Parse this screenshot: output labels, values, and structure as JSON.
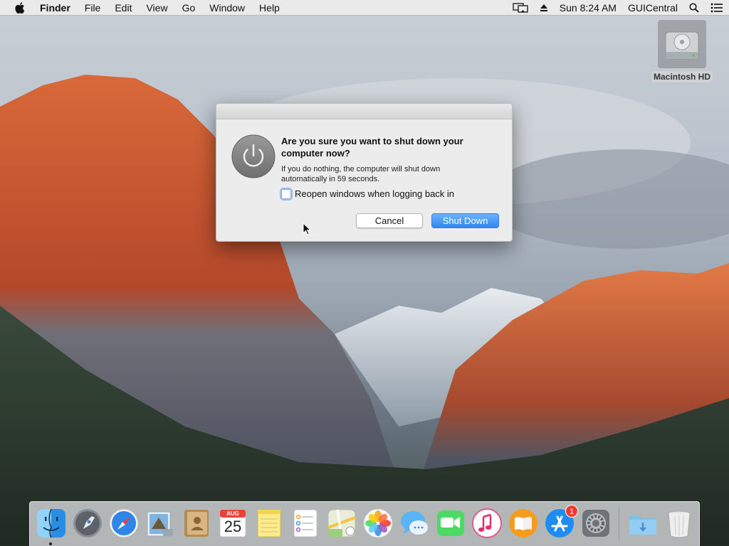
{
  "menubar": {
    "app_name": "Finder",
    "menus": [
      "File",
      "Edit",
      "View",
      "Go",
      "Window",
      "Help"
    ],
    "clock": "Sun 8:24 AM",
    "username": "GUICentral"
  },
  "desktop": {
    "icons": [
      {
        "label": "Macintosh HD",
        "icon": "hard-drive-icon"
      }
    ]
  },
  "dialog": {
    "title": "Are you sure you want to shut down your computer now?",
    "message": "If you do nothing, the computer will shut down automatically in 59 seconds.",
    "checkbox_label": "Reopen windows when logging back in",
    "checkbox_checked": false,
    "cancel_label": "Cancel",
    "confirm_label": "Shut Down",
    "icon": "power-icon",
    "accent_color": "#2f86f0"
  },
  "dock": {
    "calendar": {
      "month": "AUG",
      "day": "25"
    },
    "app_store_badge": "1",
    "items": [
      "finder-icon",
      "launchpad-icon",
      "safari-icon",
      "mail-icon",
      "contacts-icon",
      "calendar-icon",
      "notes-icon",
      "reminders-icon",
      "maps-icon",
      "photos-icon",
      "messages-icon",
      "facetime-icon",
      "itunes-icon",
      "ibooks-icon",
      "app-store-icon",
      "system-preferences-icon",
      "downloads-folder-icon",
      "trash-icon"
    ]
  }
}
